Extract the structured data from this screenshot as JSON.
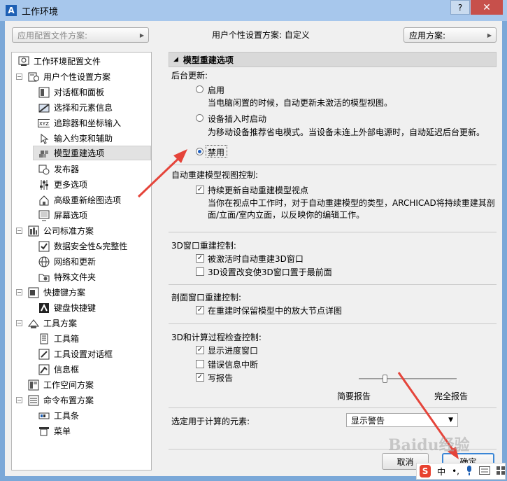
{
  "window": {
    "title": "工作环境",
    "help_label": "?",
    "close_label": "✕"
  },
  "top": {
    "profile_scheme_placeholder": "应用配置文件方案:",
    "user_scheme_text": "用户个性设置方案:  自定义",
    "apply_scheme_label": "应用方案:"
  },
  "tree": {
    "items": [
      {
        "label": "工作环境配置文件"
      },
      {
        "label": "用户个性设置方案"
      },
      {
        "label": "对话框和面板"
      },
      {
        "label": "选择和元素信息"
      },
      {
        "label": "追踪器和坐标输入"
      },
      {
        "label": "输入约束和辅助"
      },
      {
        "label": "模型重建选项"
      },
      {
        "label": "发布器"
      },
      {
        "label": "更多选项"
      },
      {
        "label": "高级重新绘图选项"
      },
      {
        "label": "屏幕选项"
      },
      {
        "label": "公司标准方案"
      },
      {
        "label": "数据安全性&完整性"
      },
      {
        "label": "网络和更新"
      },
      {
        "label": "特殊文件夹"
      },
      {
        "label": "快捷键方案"
      },
      {
        "label": "键盘快捷键"
      },
      {
        "label": "工具方案"
      },
      {
        "label": "工具箱"
      },
      {
        "label": "工具设置对话框"
      },
      {
        "label": "信息框"
      },
      {
        "label": "工作空间方案"
      },
      {
        "label": "命令布置方案"
      },
      {
        "label": "工具条"
      },
      {
        "label": "菜单"
      }
    ]
  },
  "panel": {
    "header": "模型重建选项",
    "background_update": {
      "label": "后台更新:",
      "options": [
        {
          "label": "启用",
          "desc": "当电脑闲置的时候，自动更新未激活的模型视图。",
          "selected": false
        },
        {
          "label": "设备插入时启动",
          "desc": "为移动设备推荐省电模式。当设备未连上外部电源时，自动延迟后台更新。",
          "selected": false
        },
        {
          "label": "禁用",
          "desc": "",
          "selected": true
        }
      ]
    },
    "auto_rebuild": {
      "label": "自动重建模型视图控制:",
      "checkbox": "持续更新自动重建模型视点",
      "checked": true,
      "desc_line1": "当你在视点中工作时，对于自动重建模型的类型，ARCHICAD将持续重建其剖",
      "desc_line2": "面/立面/室内立面，以反映你的编辑工作。"
    },
    "window_3d": {
      "label": "3D窗口重建控制:",
      "items": [
        {
          "label": "被激活时自动重建3D窗口",
          "checked": true
        },
        {
          "label": "3D设置改变使3D窗口置于最前面",
          "checked": false
        }
      ]
    },
    "section_window": {
      "label": "剖面窗口重建控制:",
      "items": [
        {
          "label": "在重建时保留模型中的放大节点详图",
          "checked": true
        }
      ]
    },
    "calc_check": {
      "label": "3D和计算过程检查控制:",
      "items": [
        {
          "label": "显示进度窗口",
          "checked": true
        },
        {
          "label": "错误信息中断",
          "checked": false
        },
        {
          "label": "写报告",
          "checked": true
        }
      ],
      "slider_min_label": "简要报告",
      "slider_max_label": "完全报告",
      "slider_value": 0.27
    },
    "calc_elements": {
      "label": "选定用于计算的元素:",
      "value": "显示警告"
    }
  },
  "buttons": {
    "cancel": "取消",
    "ok": "确定"
  },
  "watermark": "Baidu经验",
  "ime": {
    "logo": "S",
    "mode": "中",
    "punct": "•,"
  },
  "colors": {
    "title_bar": "#a7c7ec",
    "close": "#c7504b",
    "annotation_arrow": "#e5443a",
    "radio_selected": "#1f5fbf"
  }
}
